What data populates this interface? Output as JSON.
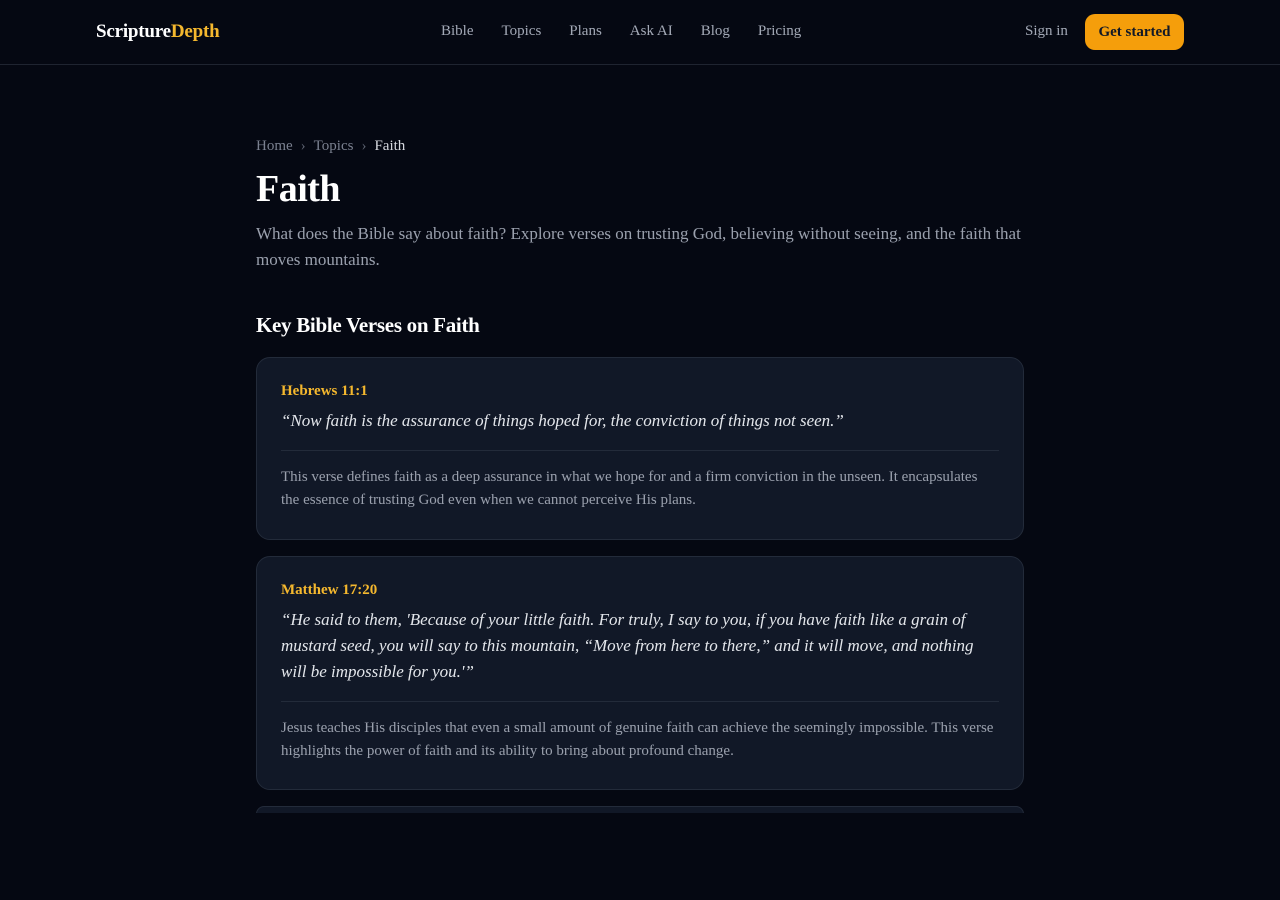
{
  "header": {
    "logo_primary": "Scripture",
    "logo_accent": "Depth",
    "nav": [
      "Bible",
      "Topics",
      "Plans",
      "Ask AI",
      "Blog",
      "Pricing"
    ],
    "sign_in": "Sign in",
    "get_started": "Get started"
  },
  "breadcrumb": {
    "home": "Home",
    "topics": "Topics",
    "current": "Faith",
    "separator": "›"
  },
  "page": {
    "title": "Faith",
    "intro": "What does the Bible say about faith? Explore verses on trusting God, believing without seeing, and the faith that moves mountains.",
    "section_title": "Key Bible Verses on Faith"
  },
  "verses": [
    {
      "reference": "Hebrews 11:1",
      "quote": "“Now faith is the assurance of things hoped for, the conviction of things not seen.”",
      "note": "This verse defines faith as a deep assurance in what we hope for and a firm conviction in the unseen. It encapsulates the essence of trusting God even when we cannot perceive His plans."
    },
    {
      "reference": "Matthew 17:20",
      "quote": "“He said to them, 'Because of your little faith. For truly, I say to you, if you have faith like a grain of mustard seed, you will say to this mountain, “Move from here to there,” and it will move, and nothing will be impossible for you.'”",
      "note": "Jesus teaches His disciples that even a small amount of genuine faith can achieve the seemingly impossible. This verse highlights the power of faith and its ability to bring about profound change."
    }
  ],
  "colors": {
    "background": "#050812",
    "card": "#111827",
    "accent": "#f5b82e",
    "button": "#f59e0b"
  }
}
